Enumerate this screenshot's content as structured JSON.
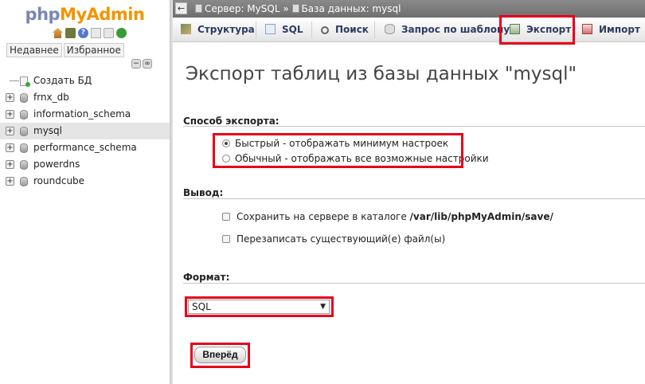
{
  "sidebar": {
    "logo": {
      "php": "php",
      "my": "My",
      "admin": "Admin"
    },
    "quick_icons": [
      "home-icon",
      "exit-icon",
      "help-icon",
      "docs-icon",
      "settings-icon",
      "reload-icon"
    ],
    "tabs": [
      "Недавнее",
      "Избранное"
    ],
    "tree": [
      {
        "label": "Создать БД",
        "icon": "new-db-icon",
        "selected": false
      },
      {
        "label": "frnx_db",
        "icon": "database-icon",
        "selected": false
      },
      {
        "label": "information_schema",
        "icon": "database-icon",
        "selected": false
      },
      {
        "label": "mysql",
        "icon": "database-icon",
        "selected": true
      },
      {
        "label": "performance_schema",
        "icon": "database-icon",
        "selected": false
      },
      {
        "label": "powerdns",
        "icon": "database-icon",
        "selected": false
      },
      {
        "label": "roundcube",
        "icon": "database-icon",
        "selected": false
      }
    ]
  },
  "breadcrumb": {
    "back": "←",
    "server": "Сервер: MySQL",
    "sep": "»",
    "database": "База данных: mysql"
  },
  "tabs": [
    {
      "label": "Структура",
      "icon": "structure-icon"
    },
    {
      "label": "SQL",
      "icon": "sql-icon"
    },
    {
      "label": "Поиск",
      "icon": "search-icon"
    },
    {
      "label": "Запрос по шаблону",
      "icon": "query-icon"
    },
    {
      "label": "Экспорт",
      "icon": "export-icon",
      "active": true
    },
    {
      "label": "Импорт",
      "icon": "import-icon"
    }
  ],
  "main": {
    "title": "Экспорт таблиц из базы данных \"mysql\"",
    "export_method": {
      "heading": "Способ экспорта:",
      "options": [
        {
          "label": "Быстрый - отображать минимум настроек",
          "checked": true
        },
        {
          "label": "Обычный - отображать все возможные настройки",
          "checked": false
        }
      ]
    },
    "output": {
      "heading": "Вывод:",
      "save_on_server_prefix": "Сохранить на сервере в каталоге ",
      "save_on_server_path": "/var/lib/phpMyAdmin/save/",
      "overwrite": "Перезаписать существующий(е) файл(ы)"
    },
    "format": {
      "heading": "Формат:",
      "selected": "SQL"
    },
    "go_button": "Вперёд"
  },
  "colors": {
    "highlight": "#e8001a",
    "tab_text": "#2e3a63",
    "logo_orange": "#f29400",
    "logo_blue": "#7a86b8"
  }
}
